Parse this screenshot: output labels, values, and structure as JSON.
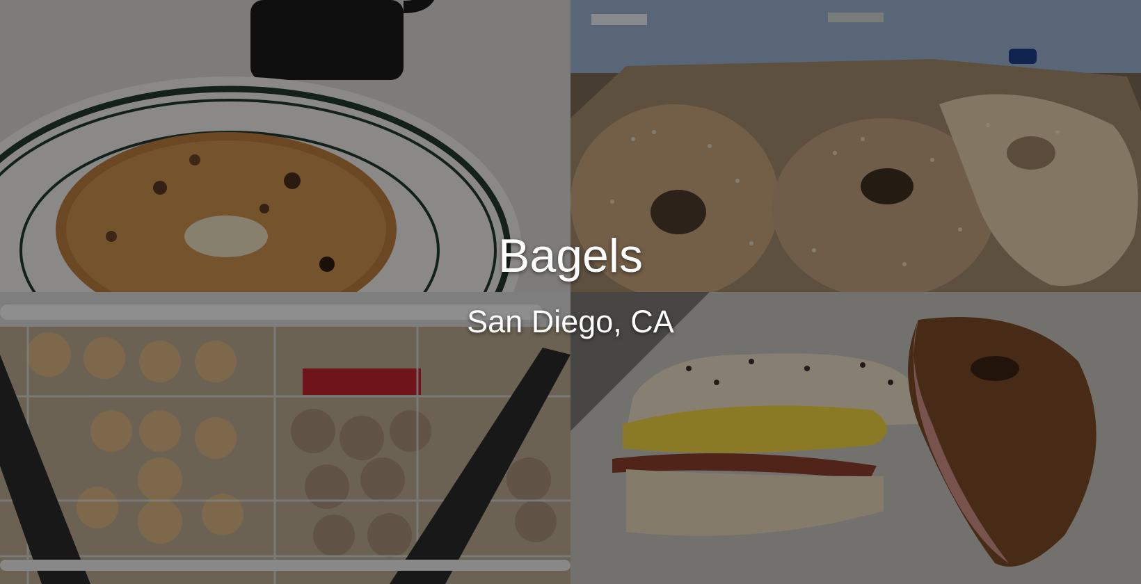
{
  "hero": {
    "title": "Bagels",
    "subtitle": "San Diego, CA"
  },
  "photos": [
    {
      "subject": "onion bagel on striped plate with coffee mug"
    },
    {
      "subject": "sesame bagels on paper bag by the bay"
    },
    {
      "subject": "bagels in wire display baskets"
    },
    {
      "subject": "bacon and egg bagel sandwich with cream cheese bagel"
    }
  ]
}
